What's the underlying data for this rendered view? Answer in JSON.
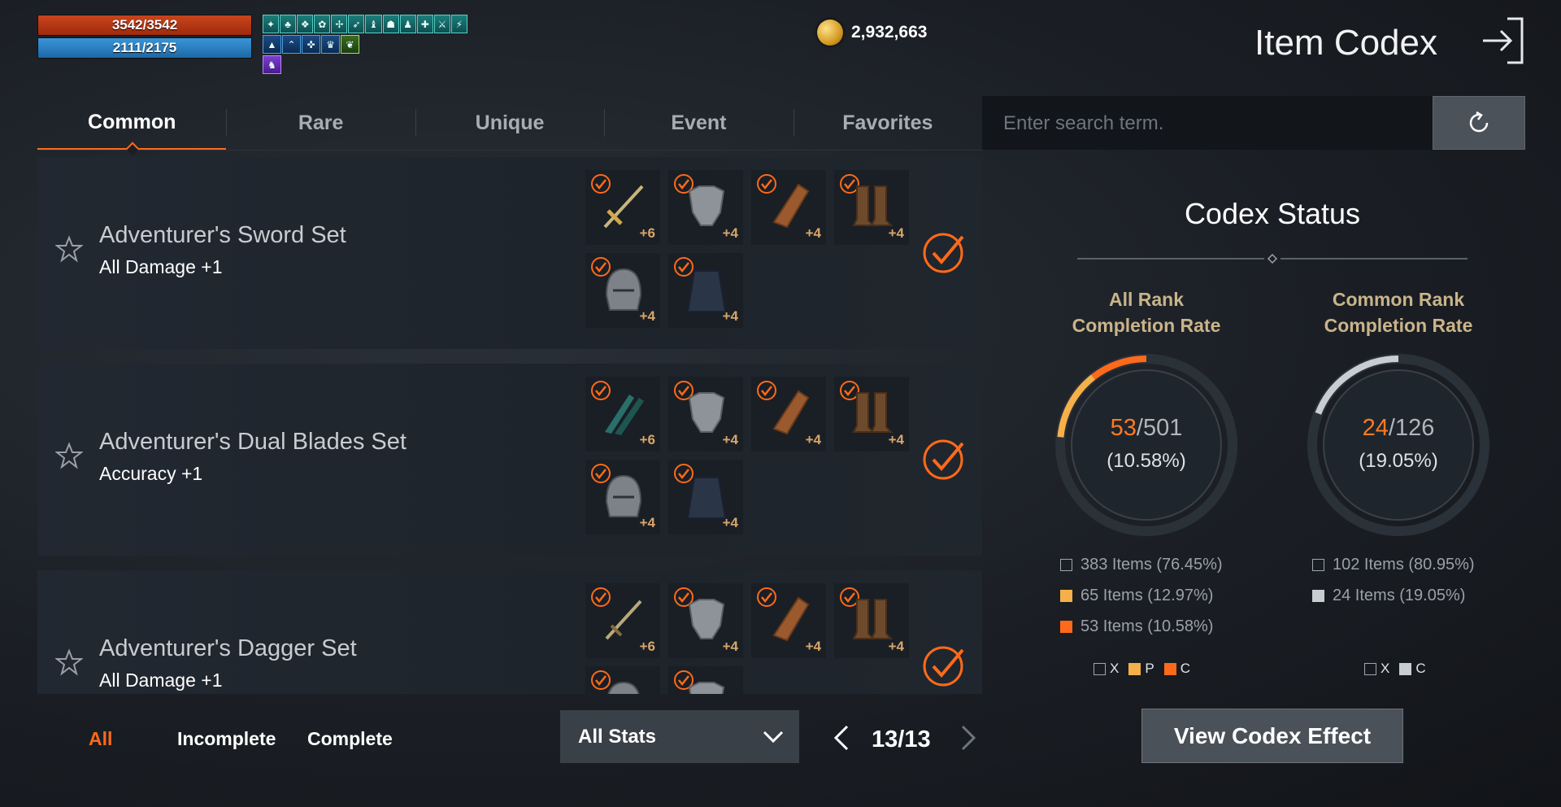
{
  "hud": {
    "hp": "3542/3542",
    "mp": "2111/2175",
    "hp_color": "#c8451c",
    "mp_color": "#3a95d8"
  },
  "currency": {
    "gold": "2,932,663"
  },
  "header": {
    "title": "Item Codex"
  },
  "tabs": [
    {
      "label": "Common",
      "active": true
    },
    {
      "label": "Rare",
      "active": false
    },
    {
      "label": "Unique",
      "active": false
    },
    {
      "label": "Event",
      "active": false
    },
    {
      "label": "Favorites",
      "active": false
    }
  ],
  "search": {
    "placeholder": "Enter search term."
  },
  "sets": [
    {
      "name": "Adventurer's Sword Set",
      "stat": "All Damage +1",
      "items": [
        {
          "icon": "sword-icon",
          "plus": "+6"
        },
        {
          "icon": "chest-armor-icon",
          "plus": "+4"
        },
        {
          "icon": "gauntlet-icon",
          "plus": "+4"
        },
        {
          "icon": "boots-icon",
          "plus": "+4"
        },
        {
          "icon": "helmet-icon",
          "plus": "+4"
        },
        {
          "icon": "cloak-icon",
          "plus": "+4"
        }
      ]
    },
    {
      "name": "Adventurer's Dual Blades Set",
      "stat": "Accuracy +1",
      "items": [
        {
          "icon": "dual-blades-icon",
          "plus": "+6"
        },
        {
          "icon": "chest-armor-icon",
          "plus": "+4"
        },
        {
          "icon": "gauntlet-icon",
          "plus": "+4"
        },
        {
          "icon": "boots-icon",
          "plus": "+4"
        },
        {
          "icon": "helmet-icon",
          "plus": "+4"
        },
        {
          "icon": "cloak-icon",
          "plus": "+4"
        }
      ]
    },
    {
      "name": "Adventurer's Dagger Set",
      "stat": "All Damage +1",
      "items": [
        {
          "icon": "dagger-icon",
          "plus": "+6"
        },
        {
          "icon": "chest-armor-icon",
          "plus": "+4"
        },
        {
          "icon": "gauntlet-icon",
          "plus": "+4"
        },
        {
          "icon": "boots-icon",
          "plus": "+4"
        },
        {
          "icon": "helmet-icon",
          "plus": ""
        },
        {
          "icon": "cloak-icon",
          "plus": ""
        }
      ]
    }
  ],
  "filters": {
    "all": "All",
    "incomplete": "Incomplete",
    "complete": "Complete",
    "active": "All"
  },
  "stats_dropdown": {
    "selected": "All Stats"
  },
  "pager": {
    "label": "13/13"
  },
  "codex_status": {
    "title": "Codex Status",
    "all_rank": {
      "title_line1": "All Rank",
      "title_line2": "Completion Rate",
      "collected": "53",
      "total": "/501",
      "percent": "(10.58%)",
      "fraction": 0.1058,
      "partial_fraction": 0.1297,
      "legend": [
        {
          "text": "383 Items (76.45%)",
          "key": "x"
        },
        {
          "text": "65 Items (12.97%)",
          "key": "p"
        },
        {
          "text": "53 Items (10.58%)",
          "key": "c"
        }
      ],
      "keys": [
        "X",
        "P",
        "C"
      ]
    },
    "common_rank": {
      "title_line1": "Common Rank",
      "title_line2": "Completion Rate",
      "collected": "24",
      "total": "/126",
      "percent": "(19.05%)",
      "fraction": 0.1905,
      "legend": [
        {
          "text": "102 Items (80.95%)",
          "key": "x"
        },
        {
          "text": "24 Items (19.05%)",
          "key": "g"
        }
      ],
      "keys": [
        "X",
        "C"
      ]
    },
    "button": "View Codex Effect"
  },
  "colors": {
    "accent": "#ff6a1a",
    "partial": "#f6b04a",
    "common_fill": "#c8cdd1"
  }
}
